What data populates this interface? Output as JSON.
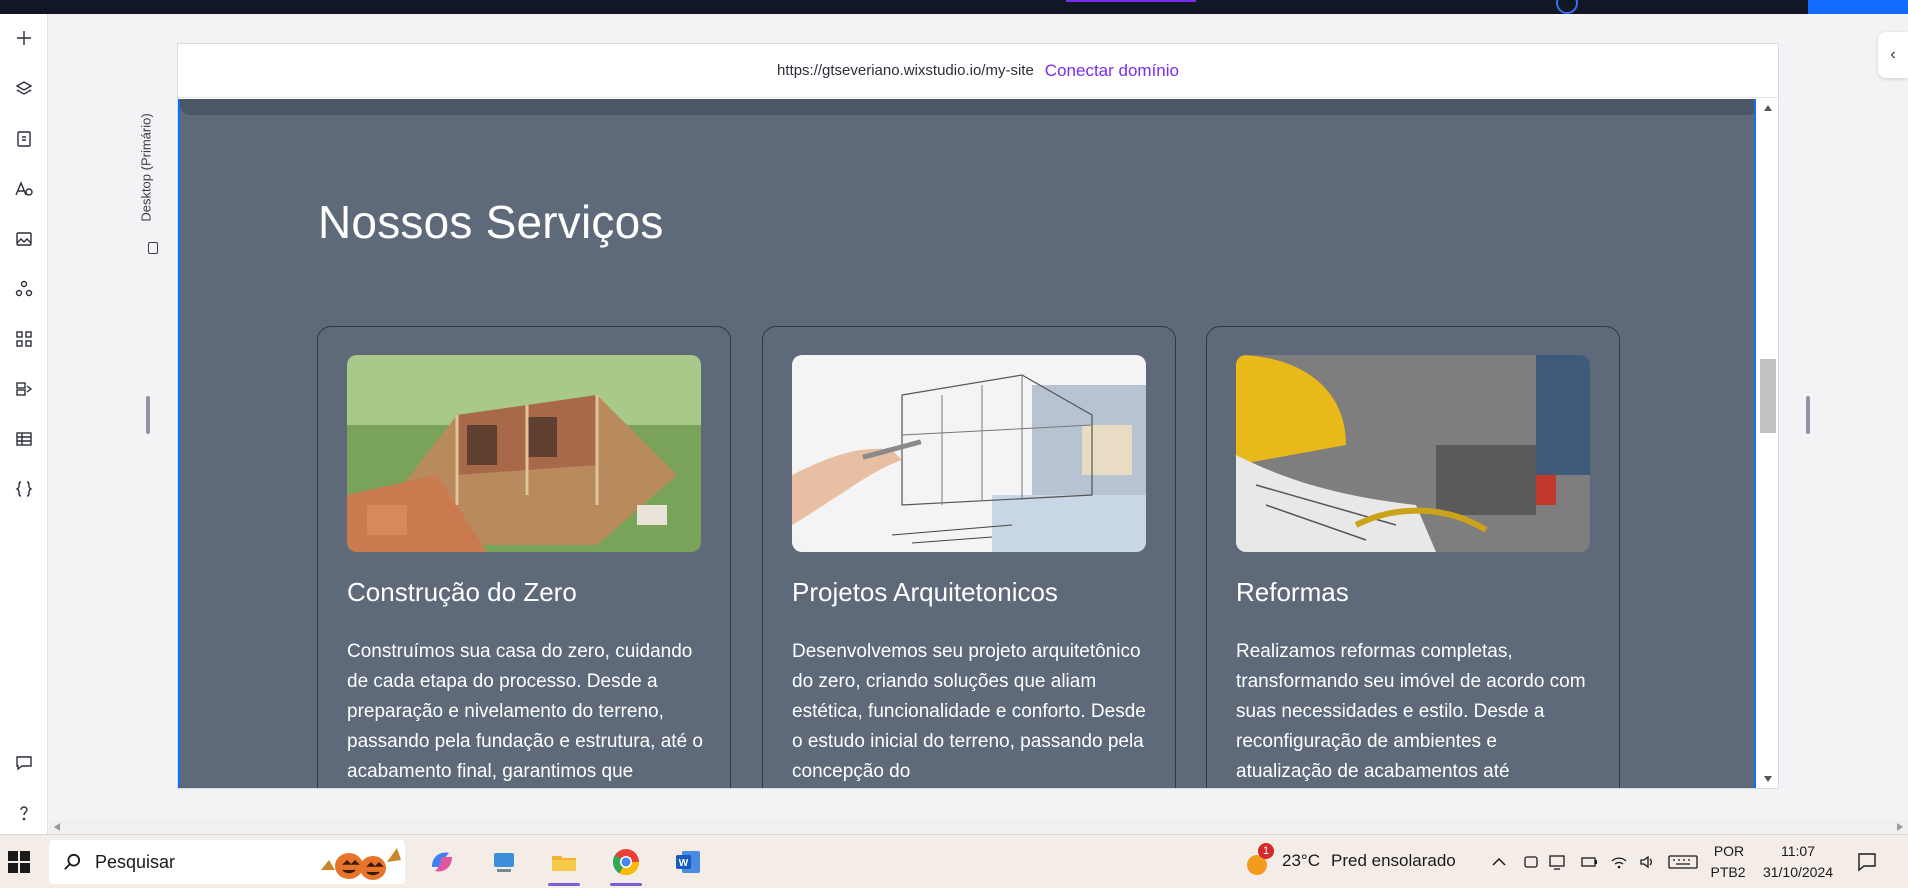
{
  "browser": {
    "url": "https://gtseveriano.wixstudio.io/my-site",
    "connect_domain": "Conectar domínio",
    "device_label": "Desktop (Primário)"
  },
  "editor_sidebar": {
    "items": [
      "add-icon",
      "layers-icon",
      "pages-icon",
      "typography-icon",
      "media-icon",
      "components-icon",
      "apps-icon",
      "business-icon",
      "cms-icon",
      "code-icon"
    ],
    "bottom": [
      "comments-icon",
      "help-icon"
    ]
  },
  "site": {
    "background": "#5e6a79",
    "section_title": "Nossos Serviços",
    "cards": [
      {
        "title": "Construção do Zero",
        "text": "Construímos sua casa do zero, cuidando de cada etapa do processo. Desde a preparação e nivelamento do terreno, passando pela fundação e estrutura, até o acabamento final, garantimos que"
      },
      {
        "title": "Projetos Arquitetonicos",
        "text": "Desenvolvemos seu projeto arquitetônico do zero, criando soluções que aliam estética, funcionalidade e conforto. Desde o estudo inicial do terreno, passando pela concepção do"
      },
      {
        "title": "Reformas",
        "text": "Realizamos reformas completas, transformando seu imóvel de acordo com suas necessidades e estilo. Desde a reconfiguração de ambientes e atualização de acabamentos até"
      }
    ]
  },
  "taskbar": {
    "search_placeholder": "Pesquisar",
    "weather_temp": "23°C",
    "weather_desc": "Pred ensolarado",
    "weather_badge": "1",
    "lang_top": "POR",
    "lang_bottom": "PTB2",
    "time": "11:07",
    "date": "31/10/2024"
  },
  "colors": {
    "accent": "#7a2cf0",
    "selection": "#116dff"
  }
}
